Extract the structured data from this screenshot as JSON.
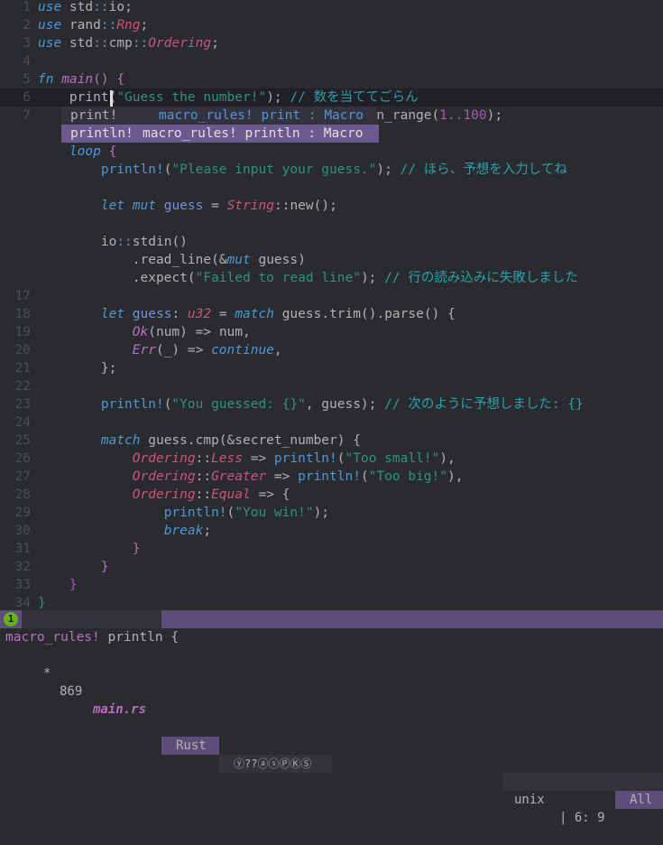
{
  "editor": {
    "line_numbers": [
      "1",
      "2",
      "3",
      "4",
      "5",
      "6",
      "7",
      "",
      "",
      "",
      "",
      "",
      "",
      "",
      "",
      "",
      "17",
      "18",
      "19",
      "20",
      "21",
      "22",
      "23",
      "24",
      "25",
      "26",
      "27",
      "28",
      "29",
      "30",
      "31",
      "32",
      "33",
      "34"
    ],
    "tokens": {
      "use": "use",
      "std": "std",
      "io": "io",
      "rand": "rand",
      "rng": "Rng",
      "cmp": "cmp",
      "ordering": "Ordering",
      "fn": "fn",
      "main": "main",
      "print": "print",
      "guess_str": "\"Guess the number!\"",
      "comment6": "// 数を当ててごらん",
      "print7": "print!",
      "gen_range": ".gen_range(",
      "range": "1..100",
      "println_l": "println!",
      "loop": "loop",
      "please_str": "\"Please input your guess.\"",
      "comment10": "// ほら、予想を入力してね",
      "let": "let",
      "mut": "mut",
      "guess": "guess",
      "string": "String",
      "new": "new",
      "stdin": "stdin",
      "read_line": ".read_line(",
      "expect": ".expect(",
      "failed_str": "\"Failed to read line\"",
      "comment15": "// 行の読み込みに失敗しました",
      "u32": "u32",
      "match": "match",
      "trim": "guess.trim().parse()",
      "ok": "Ok",
      "num": "num",
      "err": "Err",
      "continue": "continue",
      "you_guessed_str": "\"You guessed: {}\"",
      "comment23": "// 次のように予想しました: {}",
      "cmp_call": "guess.cmp(&secret_number)",
      "less": "Less",
      "greater": "Greater",
      "equal": "Equal",
      "too_small": "\"Too small!\"",
      "too_big": "\"Too big!\"",
      "you_win": "\"You win!\"",
      "break": "break"
    }
  },
  "completion_popup": {
    "items": [
      {
        "name": "print!",
        "annotation": "macro_rules! print : Macro"
      },
      {
        "name": "println!",
        "annotation": "macro_rules! println : Macro"
      }
    ]
  },
  "modeline": {
    "window_number": "1",
    "modified": "*",
    "size": "869",
    "buffer_name": "main.rs",
    "major_mode": "Rust",
    "minor_modes": "ⓨ??ⓐⓢⓅⓀⓈ",
    "eol": "unix",
    "position": "6: 9",
    "percent": "All"
  },
  "echo_area": {
    "prefix": "macro_rules!",
    "text": " println {"
  },
  "colors": {
    "background": "#292b2e",
    "keyword": "#4f97d7",
    "function": "#bc6ec5",
    "type": "#ce537a",
    "string": "#2d9574",
    "comment": "#2aa1ae",
    "modeline": "#5d4d7a",
    "popup_selected": "#6c598e"
  }
}
